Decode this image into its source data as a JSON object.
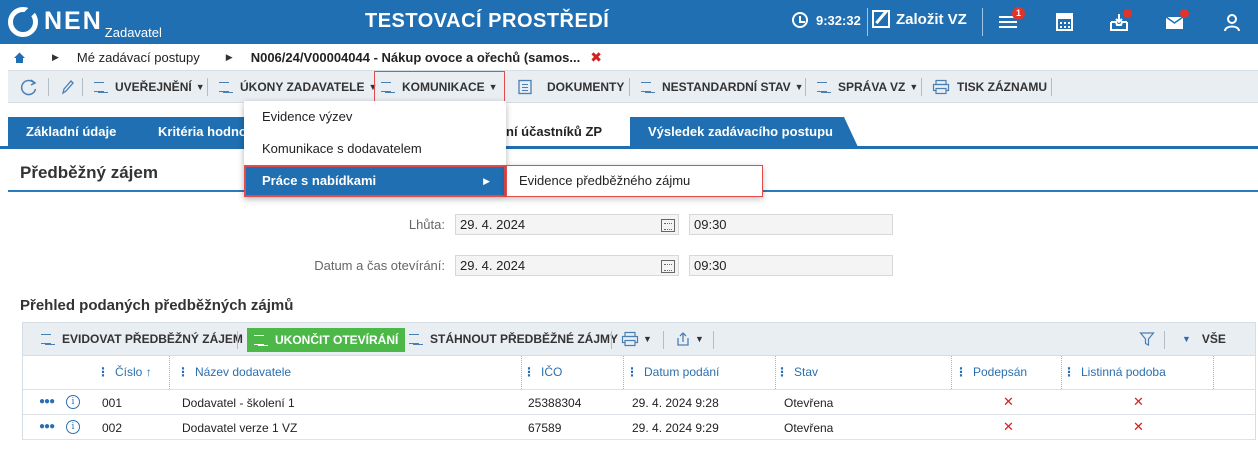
{
  "header": {
    "logo_text": "NEN",
    "logo_subtitle": "Zadavatel",
    "environment_title": "TESTOVACÍ PROSTŘEDÍ",
    "clock": "9:32:32",
    "create_label": "Založit VZ",
    "notification_count": "1"
  },
  "breadcrumb": {
    "items": [
      "Mé zadávací postupy",
      "N006/24/V00004044 - Nákup ovoce a ořechů (samos..."
    ],
    "close_symbol": "✖"
  },
  "toolbar": {
    "uverejneni": "UVEŘEJNĚNÍ",
    "ukony": "ÚKONY ZADAVATELE",
    "komunikace": "KOMUNIKACE",
    "dokumenty": "DOKUMENTY",
    "nestandardni": "NESTANDARDNÍ STAV",
    "sprava": "SPRÁVA VZ",
    "tisk": "TISK ZÁZNAMU"
  },
  "tabs": [
    {
      "label": "Základní údaje"
    },
    {
      "label": "Kritéria hodno"
    },
    {
      "label": "ní účastníků ZP"
    },
    {
      "label": "Výsledek zadávacího postupu"
    }
  ],
  "section": {
    "title": "Předběžný zájem"
  },
  "fields": {
    "lhuta_label": "Lhůta:",
    "lhuta_date": "29. 4. 2024",
    "lhuta_time": "09:30",
    "otevirani_label": "Datum a čas otevírání:",
    "otevirani_date": "29. 4. 2024",
    "otevirani_time": "09:30"
  },
  "list": {
    "title": "Přehled podaných předběžných zájmů",
    "evidovat": "EVIDOVAT PŘEDBĚŽNÝ ZÁJEM",
    "ukoncit": "UKONČIT OTEVÍRÁNÍ",
    "stahnout": "STÁHNOUT PŘEDBĚŽNÉ ZÁJMY",
    "vse": "VŠE",
    "columns": [
      "Číslo",
      "Název dodavatele",
      "IČO",
      "Datum podání",
      "Stav",
      "Podepsán",
      "Listinná podoba"
    ],
    "rows": [
      {
        "cislo": "001",
        "nazev": "Dodavatel - školení 1",
        "ico": "25388304",
        "datum": "29. 4. 2024 9:28",
        "stav": "Otevřena"
      },
      {
        "cislo": "002",
        "nazev": "Dodavatel verze 1 VZ",
        "ico": "67589",
        "datum": "29. 4. 2024 9:29",
        "stav": "Otevřena"
      }
    ]
  },
  "dropdown": {
    "items": [
      "Evidence výzev",
      "Komunikace s dodavatelem",
      "Práce s nabídkami"
    ],
    "submenu_item": "Evidence předběžného zájmu"
  },
  "colors": {
    "primary": "#1f6fb2",
    "success": "#4cb848",
    "danger": "#d42020",
    "highlight_border": "#e04b4b"
  }
}
